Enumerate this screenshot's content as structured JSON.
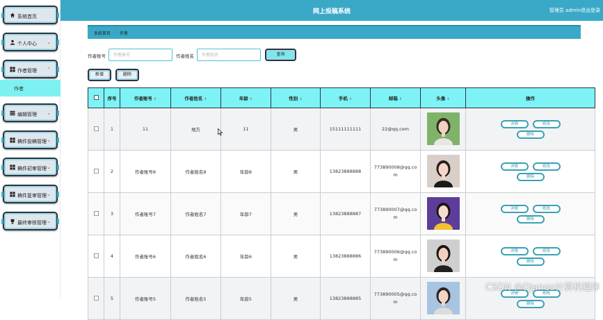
{
  "header": {
    "title": "网上投稿系统",
    "user": "管理员 admin",
    "logout": "退出登录"
  },
  "sidebar": {
    "items": [
      {
        "label": "系统首页",
        "icon": "home-icon"
      },
      {
        "label": "个人中心",
        "icon": "user-icon"
      },
      {
        "label": "作者管理",
        "icon": "grid-icon"
      },
      {
        "label": "编辑管理",
        "icon": "list-icon"
      },
      {
        "label": "稿件投稿管理",
        "icon": "grid-icon"
      },
      {
        "label": "稿件初审管理",
        "icon": "grid-icon"
      },
      {
        "label": "稿件复审管理",
        "icon": "grid-icon"
      },
      {
        "label": "最终审核管理",
        "icon": "trophy-icon"
      }
    ],
    "active_sub": "作者"
  },
  "breadcrumb": {
    "home": "系统首页",
    "sep": "⋮",
    "current": "作者"
  },
  "search": {
    "account_label": "作者账号",
    "account_placeholder": "作者账号",
    "name_label": "作者姓名",
    "name_placeholder": "作者姓名",
    "query_button": "查询"
  },
  "actions": {
    "add": "新增",
    "delete": "删除"
  },
  "table": {
    "headers": [
      "序号",
      "作者账号",
      "作者姓名",
      "年龄",
      "性别",
      "手机",
      "邮箱",
      "头像",
      "操作"
    ],
    "rows": [
      {
        "no": "1",
        "account": "11",
        "name": "地方",
        "age": "11",
        "gender": "男",
        "phone": "15111111111",
        "email": "22@qq.com"
      },
      {
        "no": "2",
        "account": "作者账号8",
        "name": "作者姓名8",
        "age": "年龄8",
        "gender": "男",
        "phone": "13823888888",
        "email": "773890008@qq.com"
      },
      {
        "no": "3",
        "account": "作者账号7",
        "name": "作者姓名7",
        "age": "年龄7",
        "gender": "男",
        "phone": "13823888887",
        "email": "773890007@qq.com"
      },
      {
        "no": "4",
        "account": "作者账号6",
        "name": "作者姓名6",
        "age": "年龄6",
        "gender": "男",
        "phone": "13823888886",
        "email": "773890006@qq.com"
      },
      {
        "no": "5",
        "account": "作者账号5",
        "name": "作者姓名5",
        "age": "年龄5",
        "gender": "男",
        "phone": "13823888885",
        "email": "773890005@qq.com"
      }
    ],
    "op_labels": {
      "detail": "详情",
      "edit": "修改",
      "delete": "删除"
    }
  },
  "watermark": "CSDN @Django计算机程序",
  "colors": {
    "header": "#3aa9c8",
    "accent": "#7df3f6",
    "border": "#2b3440"
  }
}
